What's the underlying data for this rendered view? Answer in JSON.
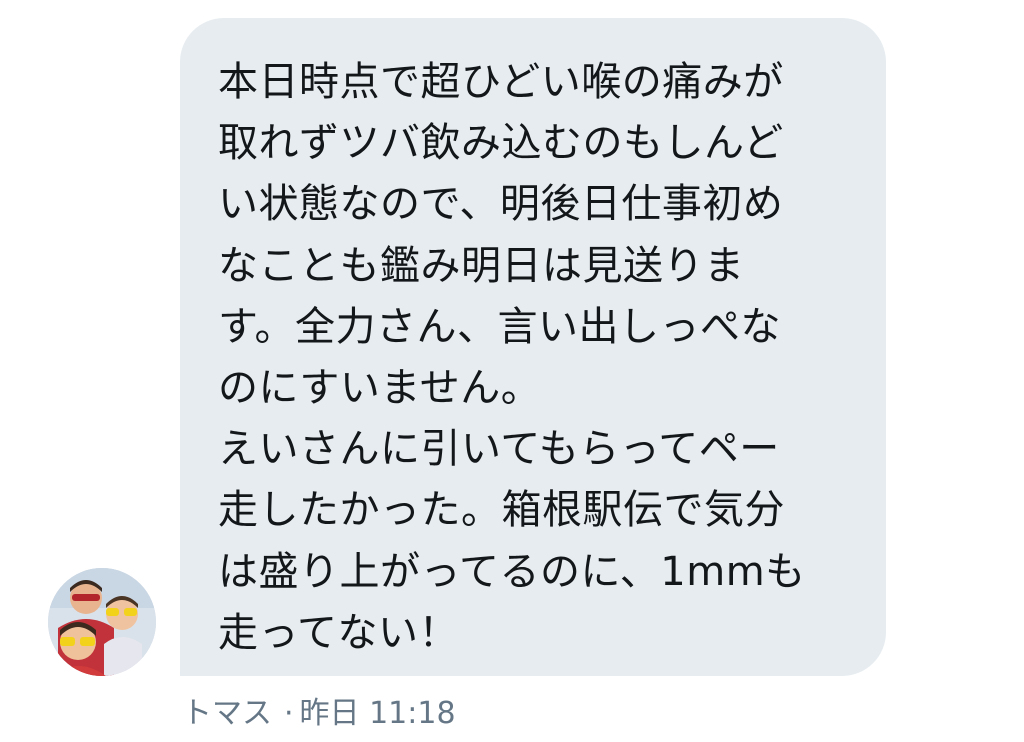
{
  "message": {
    "lines": [
      "本日時点で超ひどい喉の痛みが",
      "取れずツバ飲み込むのもしんど",
      "い状態なので、明後日仕事初め",
      "なことも鑑み明日は見送りま",
      "す。全力さん、言い出しっぺな",
      "のにすいません。",
      "えいさんに引いてもらってペー",
      "走したかった。箱根駅伝で気分",
      "は盛り上がってるのに、1mmも",
      "走ってない！"
    ]
  },
  "meta": {
    "sender": "トマス",
    "separator": "·",
    "time": "昨日 11:18"
  },
  "colors": {
    "bubble": "#e6ecf0",
    "text": "#14171a",
    "meta": "#657786"
  }
}
